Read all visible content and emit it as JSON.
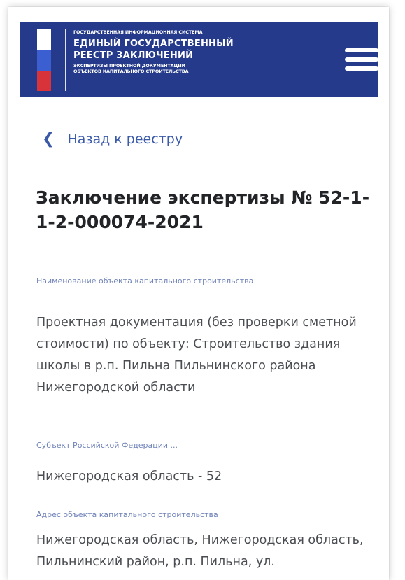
{
  "header": {
    "system_line": "ГОСУДАРСТВЕННАЯ ИНФОРМАЦИОННАЯ СИСТЕМА",
    "title_line1": "ЕДИНЫЙ ГОСУДАРСТВЕННЫЙ",
    "title_line2": "РЕЕСТР ЗАКЛЮЧЕНИЙ",
    "subtitle_line1": "ЭКСПЕРТИЗЫ ПРОЕКТНОЙ ДОКУМЕНТАЦИИ",
    "subtitle_line2": "ОБЪЕКТОВ КАПИТАЛЬНОГО СТРОИТЕЛЬСТВА",
    "flag_colors": [
      "#ffffff",
      "#3b5fd0",
      "#d8323a"
    ],
    "background_color": "#253a8a",
    "menu_icon": "hamburger-menu-icon"
  },
  "back_link": {
    "icon": "chevron-left-icon",
    "label": "Назад к реестру"
  },
  "page_title": "Заключение экспертизы № 52-1-1-2-000074-2021",
  "fields": [
    {
      "label": "Наименование объекта капитального строительства",
      "value": "Проектная документация (без проверки сметной стоимости) по объекту: Строительство здания школы в р.п. Пильна Пильнинского района Нижегородской области"
    },
    {
      "label": "Субъект Российской Федерации ...",
      "value": "Нижегородская область - 52"
    },
    {
      "label": "Адрес объекта капитального строительства",
      "value": "Нижегородская область, Нижегородская область, Пильнинский район, р.п. Пильна, ул."
    }
  ]
}
